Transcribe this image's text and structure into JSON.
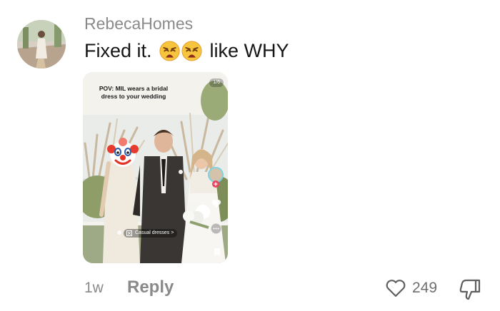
{
  "comment": {
    "username": "RebecaHomes",
    "text_start": "Fixed it.",
    "emoji": [
      "weary-face-emoji",
      "weary-face-emoji"
    ],
    "text_end": "like WHY"
  },
  "media": {
    "page_indicator": "1/6",
    "caption_line1": "POV: MIL wears a bridal",
    "caption_line2": "dress to your wedding",
    "pill_label": "Casual dresses",
    "pill_chevron": ">",
    "side_icons": [
      "profile-avatar-icon",
      "plus-icon",
      "heart-icon",
      "more-icon",
      "bookmark-icon"
    ],
    "overlay_emoji": "clown-face-emoji"
  },
  "footer": {
    "time": "1w",
    "reply": "Reply",
    "likes": "249",
    "icons": [
      "heart-outline-icon",
      "dislike-icon"
    ]
  }
}
